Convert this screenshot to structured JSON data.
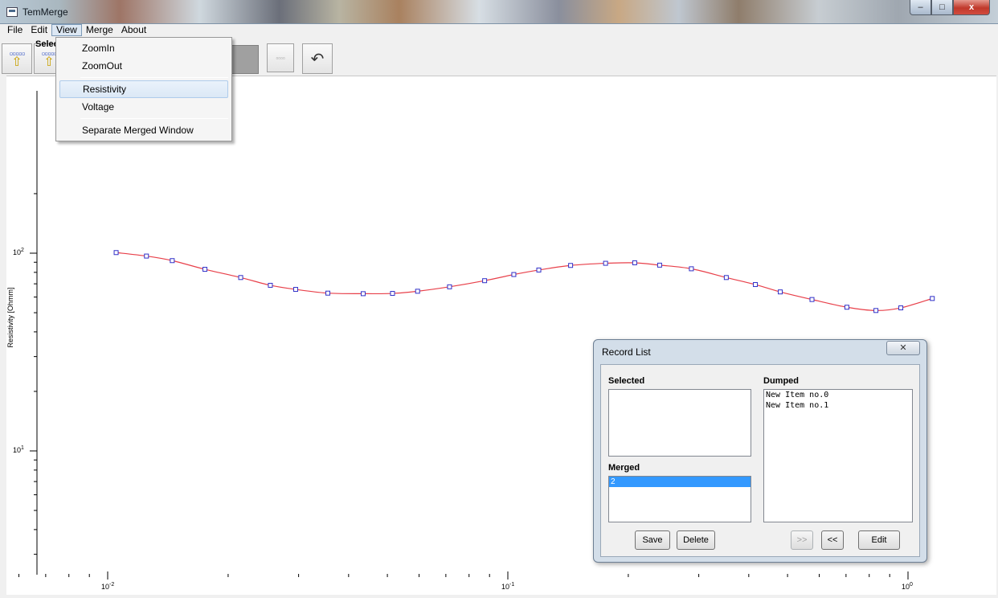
{
  "window": {
    "title": "TemMerge",
    "buttons": {
      "minimize": "–",
      "maximize": "□",
      "close": "x"
    }
  },
  "menubar": {
    "items": [
      "File",
      "Edit",
      "View",
      "Merge",
      "About"
    ],
    "active": "View"
  },
  "toolbar": {
    "dots_glyph": "▫▫▫▫▫",
    "arrow_glyph": "⇧",
    "grid_glyph": "▫▫▫▫",
    "undo_glyph": "↶"
  },
  "selected_label": "Selec",
  "view_menu": {
    "items": [
      "ZoomIn",
      "ZoomOut",
      "Resistivity",
      "Voltage",
      "Separate Merged Window"
    ],
    "highlighted": "Resistivity"
  },
  "plot": {
    "ylabel": "Resistivity [Ohmm]",
    "y_ticks": [
      {
        "base": "10",
        "exp": "2"
      },
      {
        "base": "10",
        "exp": "1"
      }
    ],
    "x_ticks": [
      {
        "base": "10",
        "exp": "-2"
      },
      {
        "base": "10",
        "exp": "-1"
      },
      {
        "base": "10",
        "exp": "0"
      }
    ]
  },
  "chart_data": {
    "type": "line",
    "xscale": "log",
    "yscale": "log",
    "xlim": [
      0.0043,
      1.12
    ],
    "ylim": [
      2.9,
      200
    ],
    "ylabel": "Resistivity [Ohmm]",
    "series_color": "#e8404a",
    "marker_color": "#3030c8",
    "x": [
      0.0105,
      0.0125,
      0.0145,
      0.0175,
      0.0215,
      0.0255,
      0.0295,
      0.0355,
      0.0435,
      0.0515,
      0.0595,
      0.0715,
      0.0875,
      0.1035,
      0.1195,
      0.1435,
      0.1755,
      0.2075,
      0.2395,
      0.2875,
      0.3515,
      0.4155,
      0.4795,
      0.5755,
      0.7035,
      0.8315,
      0.9595,
      1.15
    ],
    "y": [
      100.7,
      96.7,
      91.7,
      82.9,
      75.3,
      68.8,
      65.6,
      62.8,
      62.4,
      62.6,
      64.2,
      67.6,
      72.6,
      78.0,
      82.2,
      86.7,
      88.9,
      89.4,
      87.0,
      83.4,
      75.3,
      69.4,
      63.7,
      58.3,
      53.3,
      51.3,
      52.9,
      59.0
    ]
  },
  "record_list": {
    "title": "Record List",
    "close_glyph": "✕",
    "selected_label": "Selected",
    "dumped_label": "Dumped",
    "merged_label": "Merged",
    "selected_items": [],
    "dumped_items": [
      "New Item no.0",
      "New Item no.1"
    ],
    "merged_items": [
      "2"
    ],
    "buttons": {
      "save": "Save",
      "delete": "Delete",
      "forward": ">>",
      "back": "<<",
      "edit": "Edit"
    }
  }
}
